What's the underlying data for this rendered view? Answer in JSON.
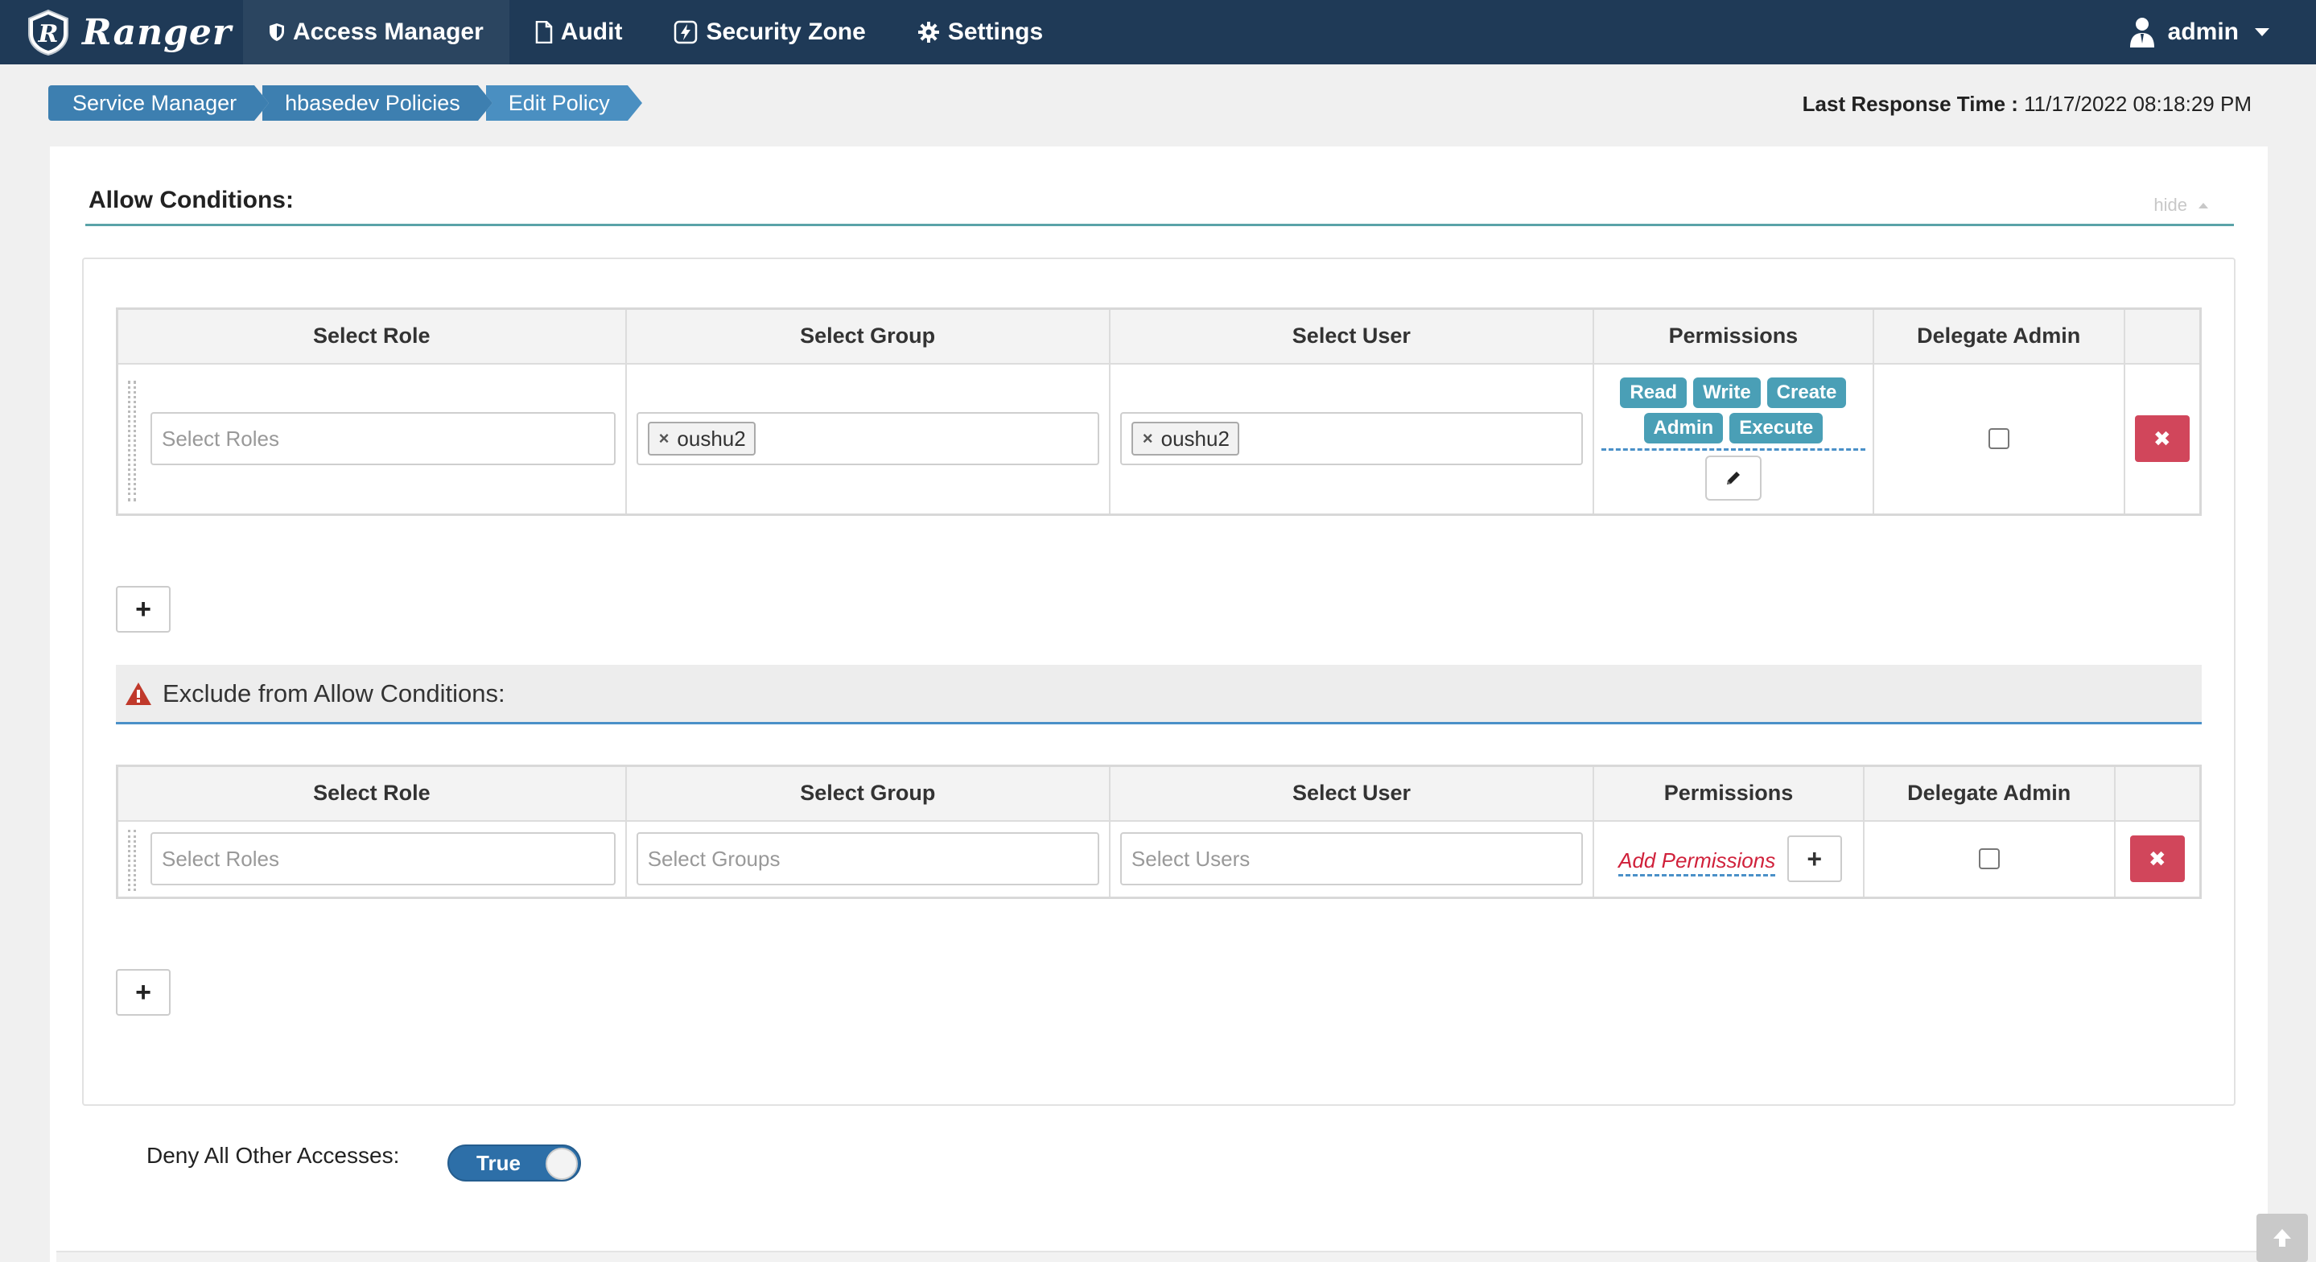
{
  "app": {
    "brand": "Ranger"
  },
  "nav": {
    "items": [
      {
        "label": "Access Manager",
        "icon": "shield-icon",
        "active": true
      },
      {
        "label": "Audit",
        "icon": "file-icon",
        "active": false
      },
      {
        "label": "Security Zone",
        "icon": "lightning-icon",
        "active": false
      },
      {
        "label": "Settings",
        "icon": "gear-icon",
        "active": false
      }
    ],
    "user": "admin"
  },
  "breadcrumb": [
    "Service Manager",
    "hbasedev Policies",
    "Edit Policy"
  ],
  "last_response": {
    "label": "Last Response Time :",
    "value": "11/17/2022 08:18:29 PM"
  },
  "allow": {
    "title": "Allow Conditions:",
    "hide_label": "hide",
    "headers": [
      "Select Role",
      "Select Group",
      "Select User",
      "Permissions",
      "Delegate Admin"
    ],
    "row": {
      "role_placeholder": "Select Roles",
      "group_tag": "oushu2",
      "user_tag": "oushu2",
      "permissions": [
        "Read",
        "Write",
        "Create",
        "Admin",
        "Execute"
      ],
      "delegate_admin": false
    }
  },
  "exclude": {
    "title": "Exclude from Allow Conditions:",
    "headers": [
      "Select Role",
      "Select Group",
      "Select User",
      "Permissions",
      "Delegate Admin"
    ],
    "row": {
      "role_placeholder": "Select Roles",
      "group_placeholder": "Select Groups",
      "user_placeholder": "Select Users",
      "add_permissions": "Add Permissions",
      "delegate_admin": false
    }
  },
  "deny": {
    "label": "Deny All Other Accesses:",
    "toggle_value": "True"
  },
  "colors": {
    "nav_bg": "#1f3a57",
    "breadcrumb": "#3d7fb0",
    "badge": "#4a9fb6",
    "danger": "#d1465b",
    "toggle": "#2d6fa8"
  }
}
